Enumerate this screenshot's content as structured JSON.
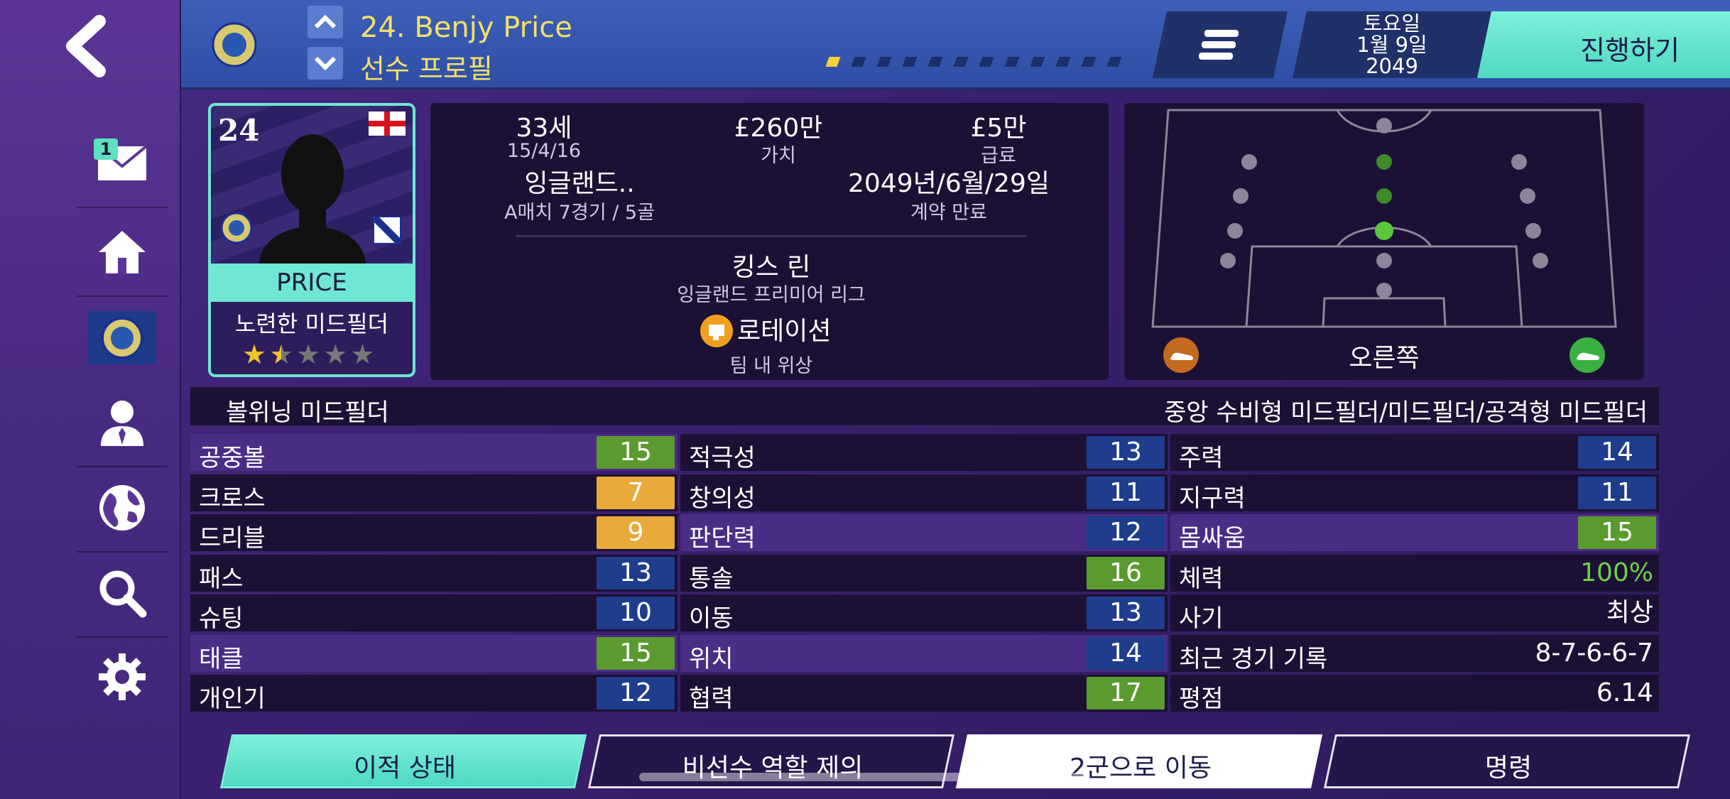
{
  "header": {
    "title": "24. Benjy Price",
    "subtitle": "선수 프로필",
    "page_dots": 12,
    "active_dot": 0,
    "date_day": "토요일",
    "date_md": "1월 9일",
    "date_year": "2049",
    "advance_label": "진행하기"
  },
  "sidebar": {
    "inbox_badge": "1",
    "items": [
      "back-icon",
      "inbox-icon",
      "home-icon",
      "club-crest",
      "person-icon",
      "globe-icon",
      "search-icon",
      "gear-icon"
    ]
  },
  "card": {
    "number": "24",
    "surname": "PRICE",
    "role": "노련한 미드필더",
    "stars": 1.5,
    "stars_max": 5,
    "nation_flag": "england"
  },
  "info": {
    "age": "33세",
    "birthdate": "15/4/16",
    "value": "£260만",
    "value_label": "가치",
    "wage": "£5만",
    "wage_label": "급료",
    "nation": "잉글랜드..",
    "caps": "A매치 7경기 / 5골",
    "contract": "2049년/6월/29일",
    "contract_label": "계약 만료",
    "club": "킹스 린",
    "league": "잉글랜드 프리미어 리그",
    "squad_status": "로테이션",
    "squad_status_label": "팀 내 위상"
  },
  "pitch": {
    "foot_label": "오른쪽"
  },
  "roles": {
    "main_role": "볼위닝 미드필더",
    "positions": "중앙 수비형 미드필더/미드필더/공격형 미드필더"
  },
  "attributes": {
    "col1": [
      {
        "label": "공중볼",
        "value": "15",
        "color": "green",
        "hl": true
      },
      {
        "label": "크로스",
        "value": "7",
        "color": "orange",
        "hl": false
      },
      {
        "label": "드리블",
        "value": "9",
        "color": "orange",
        "hl": false
      },
      {
        "label": "패스",
        "value": "13",
        "color": "blue",
        "hl": false
      },
      {
        "label": "슈팅",
        "value": "10",
        "color": "blue",
        "hl": false
      },
      {
        "label": "태클",
        "value": "15",
        "color": "green",
        "hl": true
      },
      {
        "label": "개인기",
        "value": "12",
        "color": "blue",
        "hl": false
      }
    ],
    "col2": [
      {
        "label": "적극성",
        "value": "13",
        "color": "blue",
        "hl": false
      },
      {
        "label": "창의성",
        "value": "11",
        "color": "blue",
        "hl": false
      },
      {
        "label": "판단력",
        "value": "12",
        "color": "blue",
        "hl": true
      },
      {
        "label": "통솔",
        "value": "16",
        "color": "green",
        "hl": false
      },
      {
        "label": "이동",
        "value": "13",
        "color": "blue",
        "hl": false
      },
      {
        "label": "위치",
        "value": "14",
        "color": "blue",
        "hl": true
      },
      {
        "label": "협력",
        "value": "17",
        "color": "green",
        "hl": false
      }
    ],
    "col3": [
      {
        "label": "주력",
        "value": "14",
        "color": "blue",
        "hl": false
      },
      {
        "label": "지구력",
        "value": "11",
        "color": "blue",
        "hl": false
      },
      {
        "label": "몸싸움",
        "value": "15",
        "color": "green",
        "hl": true
      },
      {
        "label": "체력",
        "value": "100%",
        "color": "plain-green",
        "hl": false
      },
      {
        "label": "사기",
        "value": "최상",
        "color": "plain",
        "hl": false
      },
      {
        "label": "최근 경기 기록",
        "value": "8-7-6-6-7",
        "color": "plain",
        "hl": false
      },
      {
        "label": "평점",
        "value": "6.14",
        "color": "plain",
        "hl": false
      }
    ]
  },
  "buttons": {
    "transfer_status": "이적 상태",
    "propose_role": "비선수 역할 제의",
    "move_reserve": "2군으로 이동",
    "orders": "명령"
  },
  "colors": {
    "accent_teal": "#6fe7d2",
    "attr_blue": "#1f3d8c",
    "attr_green": "#5a9a2e",
    "attr_orange": "#e8a93a",
    "title_yellow": "#f2e06a"
  }
}
